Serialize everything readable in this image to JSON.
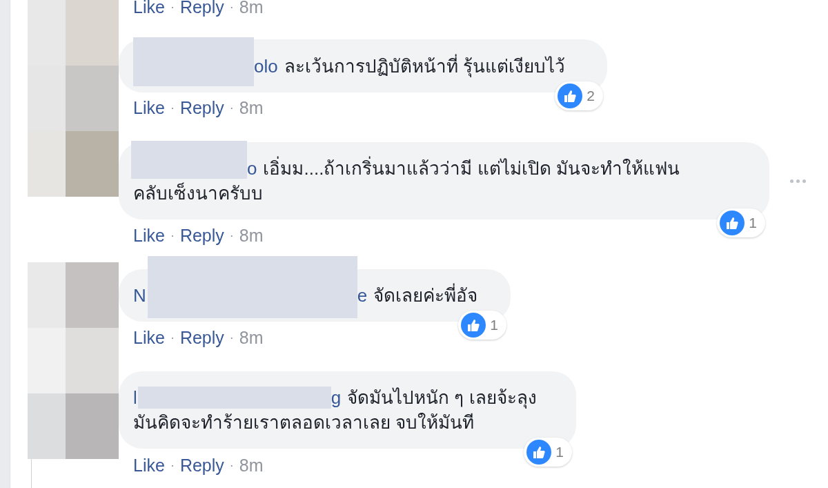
{
  "top_actions": {
    "like": "Like",
    "separator": "·",
    "reply": "Reply",
    "time": "8m"
  },
  "comments": [
    {
      "name_suffix": "olo",
      "lines": [
        "ละเว้นการปฏิบัติหน้าที่ รุ้นแต่เงียบไว้"
      ],
      "reactions": "2",
      "show_menu": false,
      "actions": {
        "like": "Like",
        "separator": "·",
        "reply": "Reply",
        "time": "8m"
      }
    },
    {
      "name_suffix": "o",
      "lines": [
        "เอิ่มม....ถ้าเกริ่นมาแล้วว่ามี แต่ไม่เปิด มันจะทำให้แฟน",
        "คลับเซ็งนาครับบ"
      ],
      "reactions": "1",
      "show_menu": true,
      "actions": {
        "like": "Like",
        "separator": "·",
        "reply": "Reply",
        "time": "8m"
      }
    },
    {
      "name_prefix": "N",
      "name_suffix": "e",
      "lines": [
        "จัดเลยค่ะพี่อัจ"
      ],
      "reactions": "1",
      "show_menu": false,
      "actions": {
        "like": "Like",
        "separator": "·",
        "reply": "Reply",
        "time": "8m"
      }
    },
    {
      "name_prefix": "l",
      "name_suffix": "g",
      "lines": [
        "จัดมันไปหนัก ๆ เลยจ้ะลุง",
        "มันคิดจะทำร้ายเราตลอดเวลาเลย จบให้มันที"
      ],
      "reactions": "1",
      "show_menu": false,
      "actions": {
        "like": "Like",
        "separator": "·",
        "reply": "Reply",
        "time": "8m"
      }
    }
  ]
}
